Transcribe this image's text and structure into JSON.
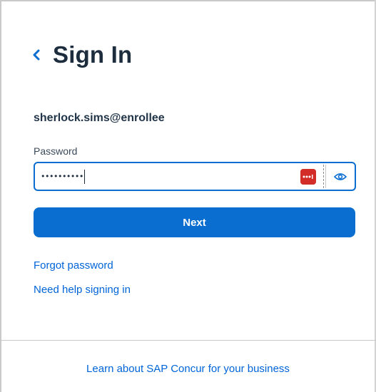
{
  "header": {
    "title": "Sign In"
  },
  "user": {
    "username": "sherlock.sims@enrollee"
  },
  "password": {
    "label": "Password",
    "masked_value": "••••••••••"
  },
  "actions": {
    "next_label": "Next",
    "forgot_password": "Forgot password",
    "need_help": "Need help signing in"
  },
  "footer": {
    "learn_more": "Learn about SAP Concur for your business"
  },
  "colors": {
    "accent": "#0a6ed1",
    "link": "#0064d9",
    "lastpass": "#d32d27"
  }
}
